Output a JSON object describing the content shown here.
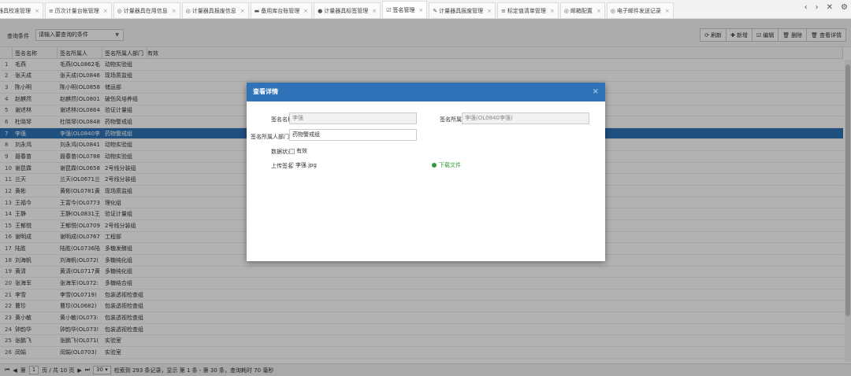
{
  "tabs": [
    {
      "label": "器具校准管理",
      "icon": ""
    },
    {
      "label": "历次计量台帐管理",
      "icon": "≡"
    },
    {
      "label": "计量器具在用信息",
      "icon": "◎"
    },
    {
      "label": "计量器具报废信息",
      "icon": "◎"
    },
    {
      "label": "备用库台账管理",
      "icon": "▬"
    },
    {
      "label": "计量器具标签管理",
      "icon": "●"
    },
    {
      "label": "签名管理",
      "icon": "☑",
      "active": true
    },
    {
      "label": "计量器具报废管理",
      "icon": "✎"
    },
    {
      "label": "标定值清单管理",
      "icon": "≡"
    },
    {
      "label": "邮箱配置",
      "icon": "◎"
    },
    {
      "label": "电子邮件发送记录",
      "icon": "◎"
    }
  ],
  "tab_controls": {
    "prev": "‹",
    "next": "›",
    "close_all": "✕",
    "settings": "⚙"
  },
  "toolbar": {
    "query_label": "查询条件",
    "query_placeholder": "请输入要查询的条件",
    "refresh": "刷新",
    "add": "新增",
    "edit": "编辑",
    "delete": "删除",
    "view": "查看详情"
  },
  "grid": {
    "columns": [
      "签名名称",
      "签名所属人",
      "签名所属人部门",
      "有效"
    ],
    "rows": [
      {
        "no": "1",
        "name": "毛燕",
        "owner": "毛燕(OL0862毛",
        "dept": "动物实验组"
      },
      {
        "no": "2",
        "name": "张天成",
        "owner": "张天成(OL0846",
        "dept": "现场质监组"
      },
      {
        "no": "3",
        "name": "陈小明",
        "owner": "陈小明(OL0858",
        "dept": "储运部"
      },
      {
        "no": "4",
        "name": "赵麒然",
        "owner": "赵麒然(OL0801",
        "dept": "破伤风培养组"
      },
      {
        "no": "5",
        "name": "谢述林",
        "owner": "谢述林(OL0864",
        "dept": "验证计量组"
      },
      {
        "no": "6",
        "name": "杜晓琴",
        "owner": "杜晓琴(OL0848",
        "dept": "药物警戒组"
      },
      {
        "no": "7",
        "name": "李强",
        "owner": "李强(OL0840李",
        "dept": "药物警戒组",
        "selected": true
      },
      {
        "no": "8",
        "name": "刘永鸿",
        "owner": "刘永鸿(OL0841",
        "dept": "动物实验组"
      },
      {
        "no": "9",
        "name": "聂春苗",
        "owner": "聂春苗(OL0788",
        "dept": "动物实验组"
      },
      {
        "no": "10",
        "name": "谢昆霖",
        "owner": "谢昆霖(OL0658",
        "dept": "2号线分装组"
      },
      {
        "no": "11",
        "name": "兰天",
        "owner": "兰天(OL0671兰",
        "dept": "2号线分装组"
      },
      {
        "no": "12",
        "name": "黄彬",
        "owner": "黄彬(OL0781黄",
        "dept": "现场质监组"
      },
      {
        "no": "13",
        "name": "王福今",
        "owner": "王富今(OL0773",
        "dept": "理化组"
      },
      {
        "no": "14",
        "name": "王静",
        "owner": "王静(OL0831王",
        "dept": "验证计量组"
      },
      {
        "no": "15",
        "name": "王郁悦",
        "owner": "王郁悦(OL0709",
        "dept": "2号线分装组"
      },
      {
        "no": "16",
        "name": "谢明成",
        "owner": "谢明成(OL0767",
        "dept": "工程部"
      },
      {
        "no": "17",
        "name": "陆胜",
        "owner": "陆胜(OL0736陆",
        "dept": "多糖发酵组"
      },
      {
        "no": "18",
        "name": "刘海帆",
        "owner": "刘海帆(OL072(",
        "dept": "多糖纯化组"
      },
      {
        "no": "19",
        "name": "黄清",
        "owner": "黄清(OL0717黄",
        "dept": "多糖纯化组"
      },
      {
        "no": "20",
        "name": "张海军",
        "owner": "张海军(OL072:",
        "dept": "多糖结合组"
      },
      {
        "no": "21",
        "name": "李雪",
        "owner": "李雪(OL0719)",
        "dept": "包装透视检查组"
      },
      {
        "no": "22",
        "name": "曹珍",
        "owner": "曹珍(OL0682)",
        "dept": "包装透视检查组"
      },
      {
        "no": "23",
        "name": "黄小敏",
        "owner": "黄小敏(OL073:",
        "dept": "包装透视检查组"
      },
      {
        "no": "24",
        "name": "钟韵华",
        "owner": "钟韵华(OL073!",
        "dept": "包装透视检查组"
      },
      {
        "no": "25",
        "name": "张鹏飞",
        "owner": "张鹏飞(OL071(",
        "dept": "实验室"
      },
      {
        "no": "26",
        "name": "闵娟",
        "owner": "闵娟(OL0703)",
        "dept": "实验室"
      }
    ]
  },
  "pager": {
    "page_label": "第",
    "page": "1",
    "of_label": "页 / 共 10 页",
    "page_size": "30",
    "summary": "检索到 293 条记录，显示 第 1 条 - 第 30 条，查询耗时 70 毫秒"
  },
  "modal": {
    "title": "查看详情",
    "close": "×",
    "name_label": "签名名称",
    "name_value": "李强",
    "owner_label": "签名所属人",
    "owner_value": "李强(OL0840李强)",
    "dept_label": "签名所属人部门",
    "dept_value": "药物警戒组",
    "status_label": "数据状态",
    "status_value": "有效",
    "upload_label": "上传签名",
    "file_name": "李强.jpg",
    "download": "下载文件"
  }
}
